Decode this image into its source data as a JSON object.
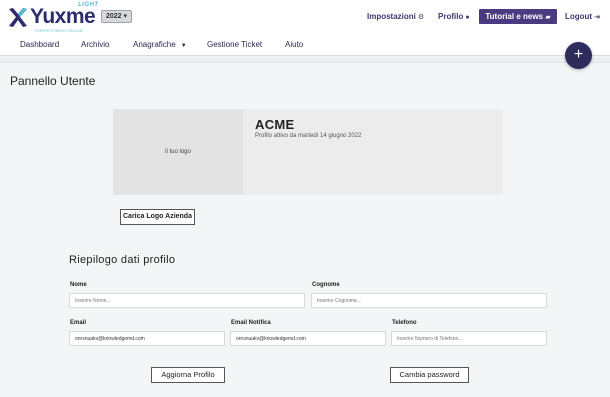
{
  "brand": {
    "name": "Yuxme",
    "edition": "LIGHT",
    "tagline": "FORFETTARIO FACILE",
    "accent": "#2d2c6e",
    "accent2": "#5bb8d6"
  },
  "header": {
    "year": "2022",
    "settings_label": "Impostazioni",
    "profile_label": "Profilo",
    "tutorial_label": "Tutorial e news",
    "logout_label": "Logout"
  },
  "menu": {
    "items": [
      {
        "label": "Dashboard"
      },
      {
        "label": "Archivio"
      },
      {
        "label": "Anagrafiche"
      },
      {
        "label": "Gestione Ticket"
      },
      {
        "label": "Aiuto"
      }
    ]
  },
  "fab": {
    "label": "+"
  },
  "page": {
    "title": "Pannello Utente"
  },
  "company": {
    "logo_placeholder": "il tuo logo",
    "name": "ACME",
    "active_since": "Profilo attivo da martedì 14 giugno 2022",
    "upload_logo_label": "Carica Logo Azienda"
  },
  "profile": {
    "title": "Riepilogo dati profilo",
    "nome_label": "Nome",
    "nome_placeholder": "Inserire Nome...",
    "cognome_label": "Cognome",
    "cognome_placeholder": "Inserire Cognome...",
    "email_label": "Email",
    "email_value": "onrsnuakv@knowledgemd.com",
    "email_notifica_label": "Email Notifica",
    "email_notifica_value": "onrsnuakv@knowledgemd.com",
    "telefono_label": "Telefono",
    "telefono_placeholder": "Inserire Numero di Telefono...",
    "update_label": "Aggiorna Profilo",
    "change_password_label": "Cambia password"
  }
}
